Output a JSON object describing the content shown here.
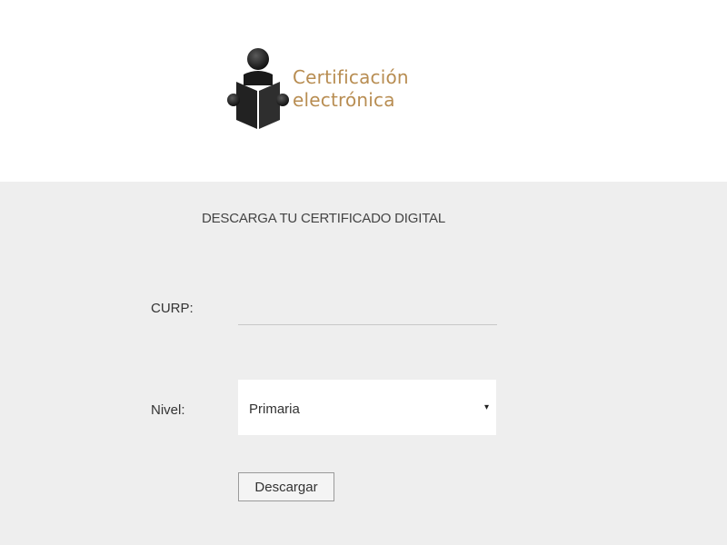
{
  "logo": {
    "line1": "Certificación",
    "line2": "electrónica",
    "icon": "reader-with-book-icon",
    "accent_color": "#b88d52"
  },
  "form": {
    "title": "DESCARGA TU CERTIFICADO DIGITAL",
    "curp_label": "CURP:",
    "curp_value": "",
    "nivel_label": "Nivel:",
    "nivel_selected": "Primaria",
    "dropdown_arrow": "▾",
    "download_label": "Descargar"
  },
  "colors": {
    "panel_background": "#eeeeee",
    "header_background": "#ffffff"
  }
}
